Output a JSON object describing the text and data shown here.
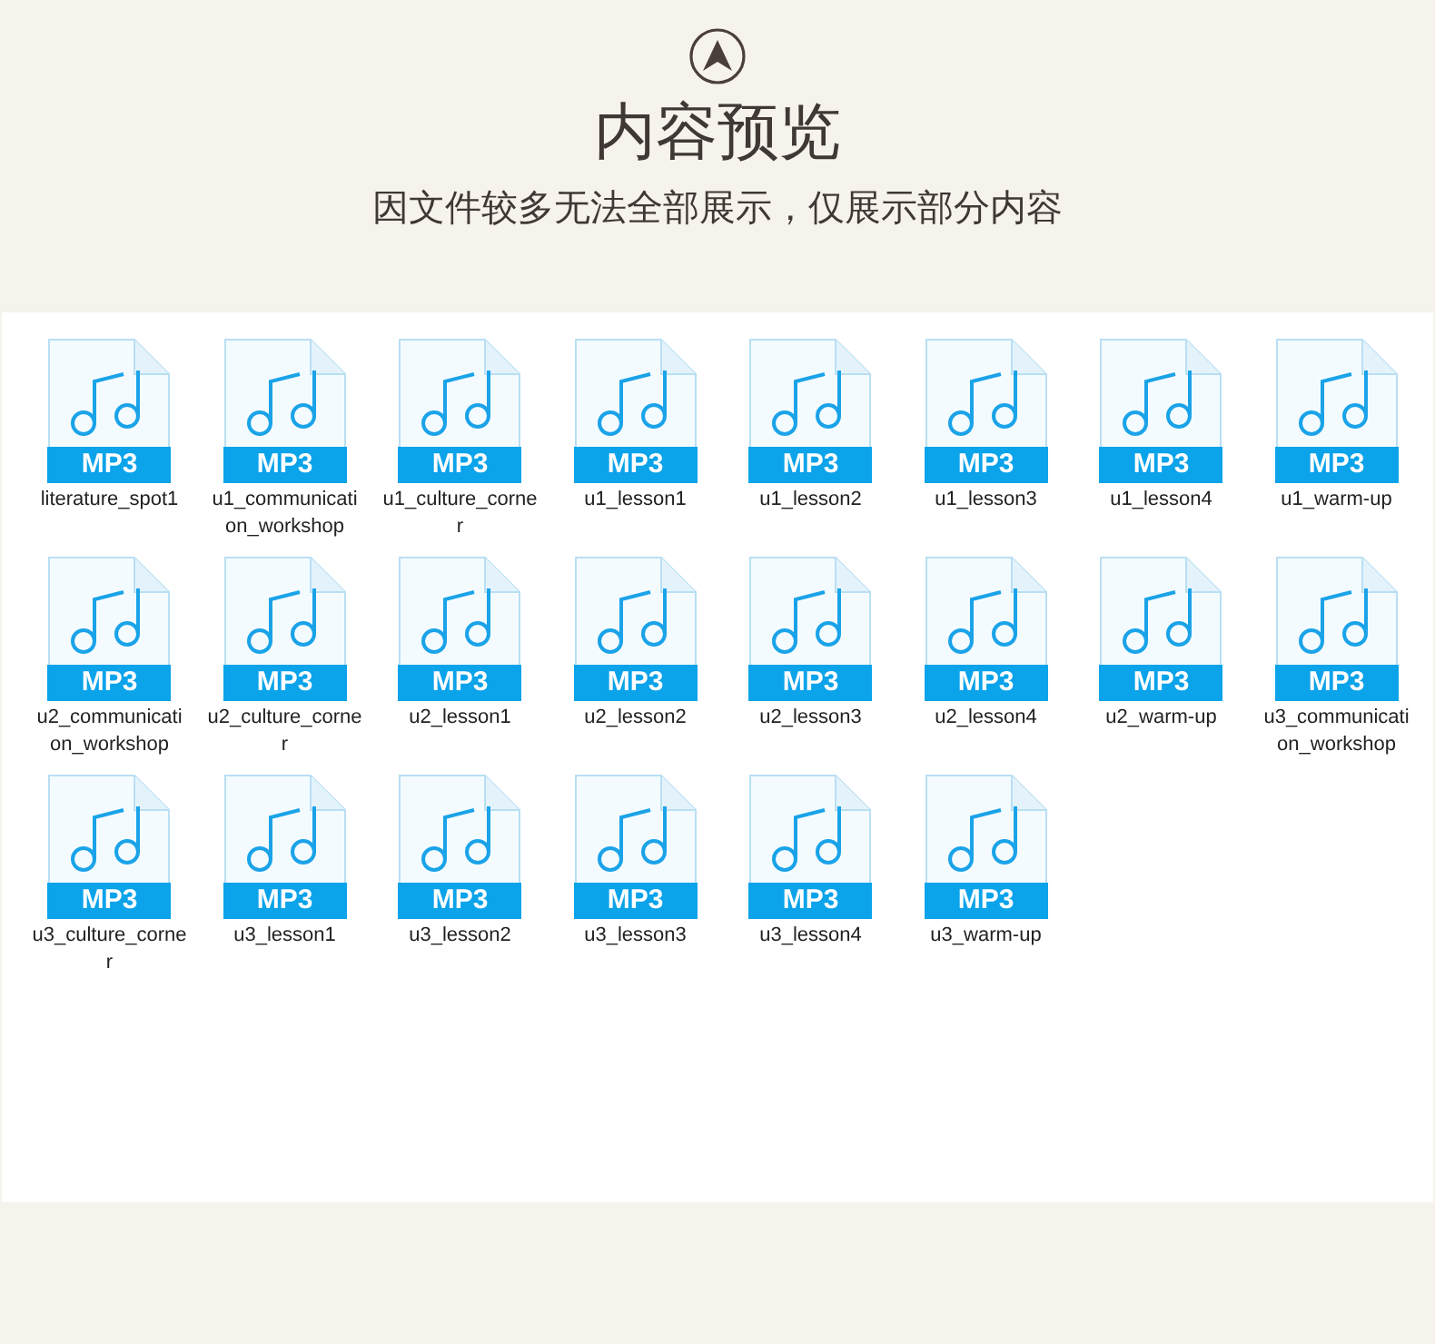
{
  "header": {
    "title": "内容预览",
    "subtitle": "因文件较多无法全部展示，仅展示部分内容"
  },
  "files": [
    {
      "name": "literature_spot1",
      "badge": "MP3"
    },
    {
      "name": "u1_communication_workshop",
      "badge": "MP3"
    },
    {
      "name": "u1_culture_corner",
      "badge": "MP3"
    },
    {
      "name": "u1_lesson1",
      "badge": "MP3"
    },
    {
      "name": "u1_lesson2",
      "badge": "MP3"
    },
    {
      "name": "u1_lesson3",
      "badge": "MP3"
    },
    {
      "name": "u1_lesson4",
      "badge": "MP3"
    },
    {
      "name": "u1_warm-up",
      "badge": "MP3"
    },
    {
      "name": "u2_communication_workshop",
      "badge": "MP3"
    },
    {
      "name": "u2_culture_corner",
      "badge": "MP3"
    },
    {
      "name": "u2_lesson1",
      "badge": "MP3"
    },
    {
      "name": "u2_lesson2",
      "badge": "MP3"
    },
    {
      "name": "u2_lesson3",
      "badge": "MP3"
    },
    {
      "name": "u2_lesson4",
      "badge": "MP3"
    },
    {
      "name": "u2_warm-up",
      "badge": "MP3"
    },
    {
      "name": "u3_communication_workshop",
      "badge": "MP3"
    },
    {
      "name": "u3_culture_corner",
      "badge": "MP3"
    },
    {
      "name": "u3_lesson1",
      "badge": "MP3"
    },
    {
      "name": "u3_lesson2",
      "badge": "MP3"
    },
    {
      "name": "u3_lesson3",
      "badge": "MP3"
    },
    {
      "name": "u3_lesson4",
      "badge": "MP3"
    },
    {
      "name": "u3_warm-up",
      "badge": "MP3"
    }
  ]
}
